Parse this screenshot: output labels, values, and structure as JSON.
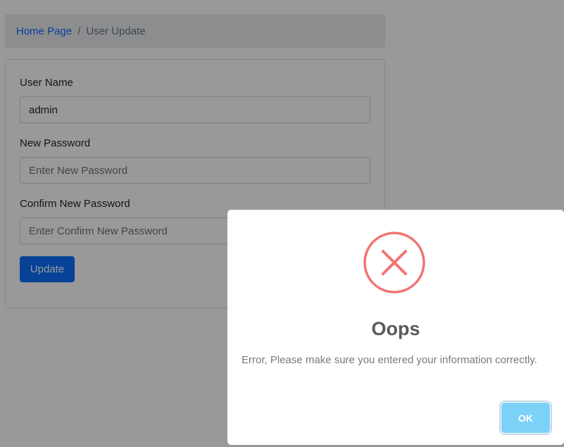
{
  "breadcrumb": {
    "home": "Home Page",
    "separator": "/",
    "current": "User Update"
  },
  "form": {
    "username": {
      "label": "User Name",
      "value": "admin"
    },
    "new_password": {
      "label": "New Password",
      "placeholder": "Enter New Password"
    },
    "confirm_password": {
      "label": "Confirm New Password",
      "placeholder": "Enter Confirm New Password"
    },
    "update_label": "Update"
  },
  "dialog": {
    "icon": "error-x-icon",
    "title": "Oops",
    "message": "Error, Please make sure you entered your information correctly.",
    "ok_label": "OK"
  },
  "colors": {
    "primary": "#0d6efd",
    "error": "#f27474",
    "ok_button": "#7cd1f9",
    "overlay": "rgba(0,0,0,0.4)"
  }
}
